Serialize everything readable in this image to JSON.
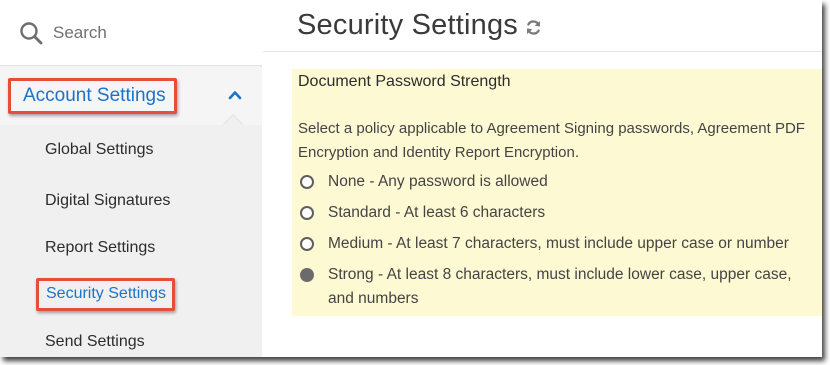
{
  "search": {
    "placeholder": "Search"
  },
  "sidebar": {
    "section_label": "Account Settings",
    "items": [
      {
        "label": "Global Settings",
        "active": false
      },
      {
        "label": "Digital Signatures",
        "active": false
      },
      {
        "label": "Report Settings",
        "active": false
      },
      {
        "label": "Security Settings",
        "active": true
      },
      {
        "label": "Send Settings",
        "active": false
      }
    ]
  },
  "main": {
    "title": "Security Settings",
    "section": {
      "title": "Document Password Strength",
      "description": "Select a policy applicable to Agreement Signing passwords, Agreement PDF Encryption and Identity Report Encryption.",
      "options": [
        {
          "label": "None - Any password is allowed",
          "selected": false
        },
        {
          "label": "Standard - At least 6 characters",
          "selected": false
        },
        {
          "label": "Medium - At least 7 characters, must include upper case or number",
          "selected": false
        },
        {
          "label": "Strong - At least 8 characters, must include lower case, upper case, and numbers",
          "selected": true
        }
      ]
    }
  },
  "colors": {
    "accent_blue": "#1a73c9",
    "highlight_red": "#e74c3c",
    "panel_yellow": "#fdf9d3"
  }
}
